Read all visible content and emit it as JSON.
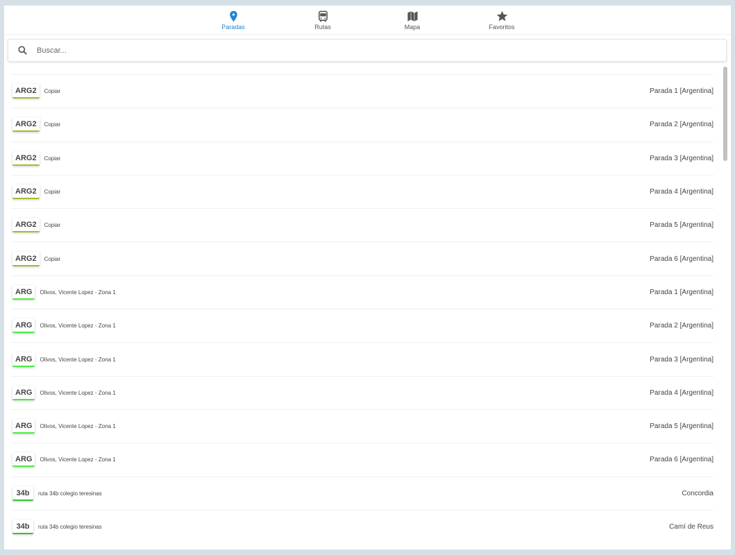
{
  "nav": {
    "tabs": [
      {
        "label": "Paradas",
        "icon": "map-pin-icon",
        "active": true
      },
      {
        "label": "Rutas",
        "icon": "bus-icon"
      },
      {
        "label": "Mapa",
        "icon": "map-icon"
      },
      {
        "label": "Favoritos",
        "icon": "star-icon"
      }
    ]
  },
  "search": {
    "placeholder": "Buscar..."
  },
  "colors": {
    "active": "#1f86d6",
    "ARG2": "#a5bd2c",
    "ARG": "#47ef3c",
    "34b": "#33c435"
  },
  "rows": [
    {
      "badge": "ARG2",
      "desc": "Copiar",
      "stop": "Parada 1 [Argentina]"
    },
    {
      "badge": "ARG2",
      "desc": "Copiar",
      "stop": "Parada 2 [Argentina]"
    },
    {
      "badge": "ARG2",
      "desc": "Copiar",
      "stop": "Parada 3 [Argentina]"
    },
    {
      "badge": "ARG2",
      "desc": "Copiar",
      "stop": "Parada 4 [Argentina]"
    },
    {
      "badge": "ARG2",
      "desc": "Copiar",
      "stop": "Parada 5 [Argentina]"
    },
    {
      "badge": "ARG2",
      "desc": "Copiar",
      "stop": "Parada 6 [Argentina]"
    },
    {
      "badge": "ARG",
      "desc": "Olivos, Vicente Lopez - Zona 1",
      "stop": "Parada 1 [Argentina]"
    },
    {
      "badge": "ARG",
      "desc": "Olivos, Vicente Lopez - Zona 1",
      "stop": "Parada 2 [Argentina]"
    },
    {
      "badge": "ARG",
      "desc": "Olivos, Vicente Lopez - Zona 1",
      "stop": "Parada 3 [Argentina]"
    },
    {
      "badge": "ARG",
      "desc": "Olivos, Vicente Lopez - Zona 1",
      "stop": "Parada 4 [Argentina]"
    },
    {
      "badge": "ARG",
      "desc": "Olivos, Vicente Lopez - Zona 1",
      "stop": "Parada 5 [Argentina]"
    },
    {
      "badge": "ARG",
      "desc": "Olivos, Vicente Lopez - Zona 1",
      "stop": "Parada 6 [Argentina]"
    },
    {
      "badge": "34b",
      "desc": "ruta 34b colegio teresinas",
      "stop": "Concordia"
    },
    {
      "badge": "34b",
      "desc": "ruta 34b colegio teresinas",
      "stop": "Camí de Reus"
    }
  ]
}
